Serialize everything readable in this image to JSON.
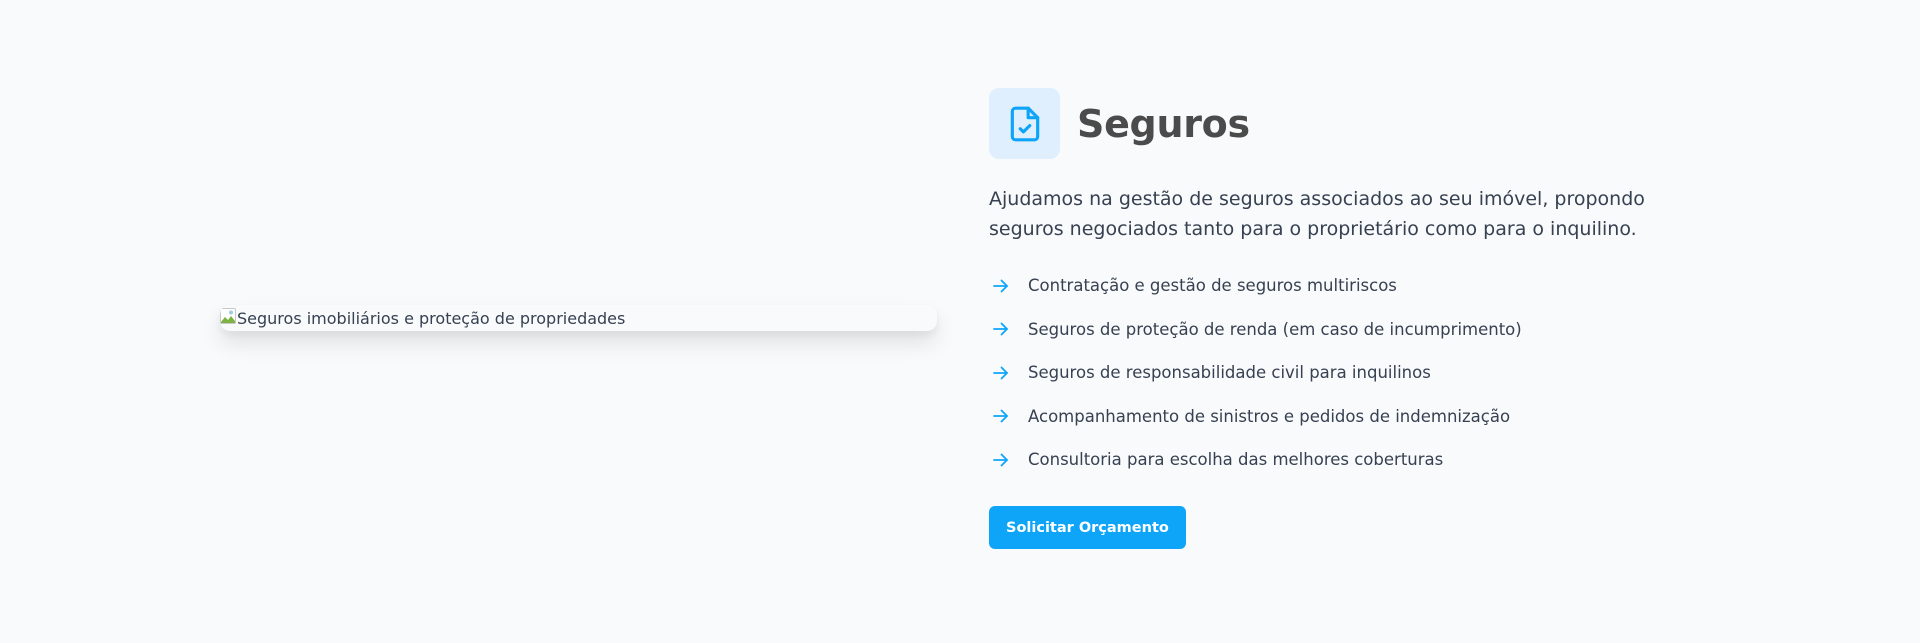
{
  "image": {
    "alt": "Seguros imobiliários e proteção de propriedades",
    "icon": "broken-image-icon"
  },
  "header": {
    "icon": "document-check-icon",
    "title": "Seguros"
  },
  "description": "Ajudamos na gestão de seguros associados ao seu imóvel, propondo seguros negociados tanto para o proprietário como para o inquilino.",
  "features": {
    "icon": "arrow-right-icon",
    "items": [
      "Contratação e gestão de seguros multiriscos",
      "Seguros de proteção de renda (em caso de incumprimento)",
      "Seguros de responsabilidade civil para inquilinos",
      "Acompanhamento de sinistros e pedidos de indemnização",
      "Consultoria para escolha das melhores coberturas"
    ]
  },
  "cta": {
    "label": "Solicitar Orçamento"
  },
  "colors": {
    "accent": "#0ea5f9",
    "icon_background": "#e0effd",
    "page_background": "#f8fafc",
    "title": "#4b4b4b",
    "text": "#374151"
  }
}
